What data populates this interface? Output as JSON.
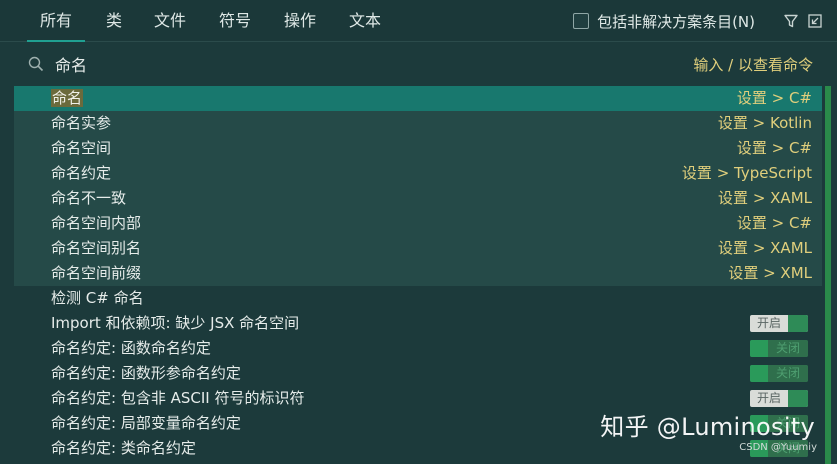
{
  "tabs": [
    {
      "label": "所有",
      "active": true
    },
    {
      "label": "类",
      "active": false
    },
    {
      "label": "文件",
      "active": false
    },
    {
      "label": "符号",
      "active": false
    },
    {
      "label": "操作",
      "active": false
    },
    {
      "label": "文本",
      "active": false
    }
  ],
  "options": {
    "include_unresolved_label": "包括非解决方案条目(N)",
    "include_unresolved_checked": false,
    "filter_icon": "filter-icon",
    "pin_icon": "open-in-window-icon"
  },
  "search": {
    "value": "命名",
    "hint": "输入 / 以查看命令",
    "icon": "search-icon"
  },
  "settings_results": [
    {
      "name_highlight": "命名",
      "name_rest": "",
      "path": "设置 > C#"
    },
    {
      "name_highlight": "",
      "name_rest": "命名实参",
      "path": "设置 > Kotlin"
    },
    {
      "name_highlight": "",
      "name_rest": "命名空间",
      "path": "设置 > C#"
    },
    {
      "name_highlight": "",
      "name_rest": "命名约定",
      "path": "设置 > TypeScript"
    },
    {
      "name_highlight": "",
      "name_rest": "命名不一致",
      "path": "设置 > XAML"
    },
    {
      "name_highlight": "",
      "name_rest": "命名空间内部",
      "path": "设置 > C#"
    },
    {
      "name_highlight": "",
      "name_rest": "命名空间别名",
      "path": "设置 > XAML"
    },
    {
      "name_highlight": "",
      "name_rest": "命名空间前缀",
      "path": "设置 > XML"
    }
  ],
  "action_results": [
    {
      "name": "检测 C# 命名",
      "toggle": null
    },
    {
      "name": "Import 和依赖项: 缺少 JSX 命名空间",
      "toggle": "开启"
    },
    {
      "name": "命名约定: 函数命名约定",
      "toggle": "关闭"
    },
    {
      "name": "命名约定: 函数形参命名约定",
      "toggle": "关闭"
    },
    {
      "name": "命名约定: 包含非 ASCII 符号的标识符",
      "toggle": "开启"
    },
    {
      "name": "命名约定: 局部变量命名约定",
      "toggle": "关闭"
    },
    {
      "name": "命名约定: 类命名约定",
      "toggle": "关闭"
    }
  ],
  "colors": {
    "accent": "#20a091",
    "selected_row": "#18786e",
    "group_row": "#254a48",
    "path_text": "#e0cf7c",
    "background": "#1c3a3b"
  },
  "watermark": {
    "main": "知乎 @Luminosity",
    "small": "CSDN @Yuumiy"
  }
}
